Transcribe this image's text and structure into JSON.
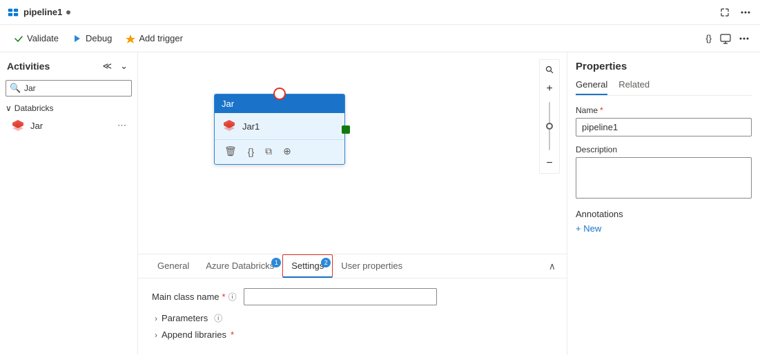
{
  "topbar": {
    "logo_label": "pipeline1",
    "tab_dot": "●",
    "expand_icon": "⤢",
    "more_icon": "···"
  },
  "toolbar": {
    "validate_label": "Validate",
    "debug_label": "Debug",
    "add_trigger_label": "Add trigger",
    "code_icon": "{}",
    "monitor_icon": "📊",
    "more_icon": "···"
  },
  "sidebar": {
    "title": "Activities",
    "collapse_icon": "≪",
    "chevron_icon": "⌄",
    "search_placeholder": "Jar",
    "search_value": "Jar",
    "group": {
      "name": "Databricks",
      "chevron": "∨"
    },
    "items": [
      {
        "label": "Jar",
        "icon": "databricks"
      }
    ]
  },
  "canvas": {
    "node": {
      "header": "Jar",
      "name": "Jar1"
    }
  },
  "bottom_panel": {
    "tabs": [
      {
        "label": "General",
        "badge": null,
        "active": false
      },
      {
        "label": "Azure Databricks",
        "badge": "1",
        "active": false
      },
      {
        "label": "Settings",
        "badge": "2",
        "active": true,
        "outlined": true
      },
      {
        "label": "User properties",
        "badge": null,
        "active": false
      }
    ],
    "collapse_icon": "∧",
    "main_class_name_label": "Main class name",
    "required_marker": "*",
    "info_icon": "ℹ",
    "parameters_label": "Parameters",
    "append_libraries_label": "Append libraries"
  },
  "right_panel": {
    "title": "Properties",
    "tabs": [
      {
        "label": "General",
        "active": true
      },
      {
        "label": "Related",
        "active": false
      }
    ],
    "name_label": "Name",
    "required_marker": "*",
    "name_value": "pipeline1",
    "description_label": "Description",
    "description_value": "",
    "annotations_label": "Annotations",
    "add_new_label": "+ New"
  }
}
